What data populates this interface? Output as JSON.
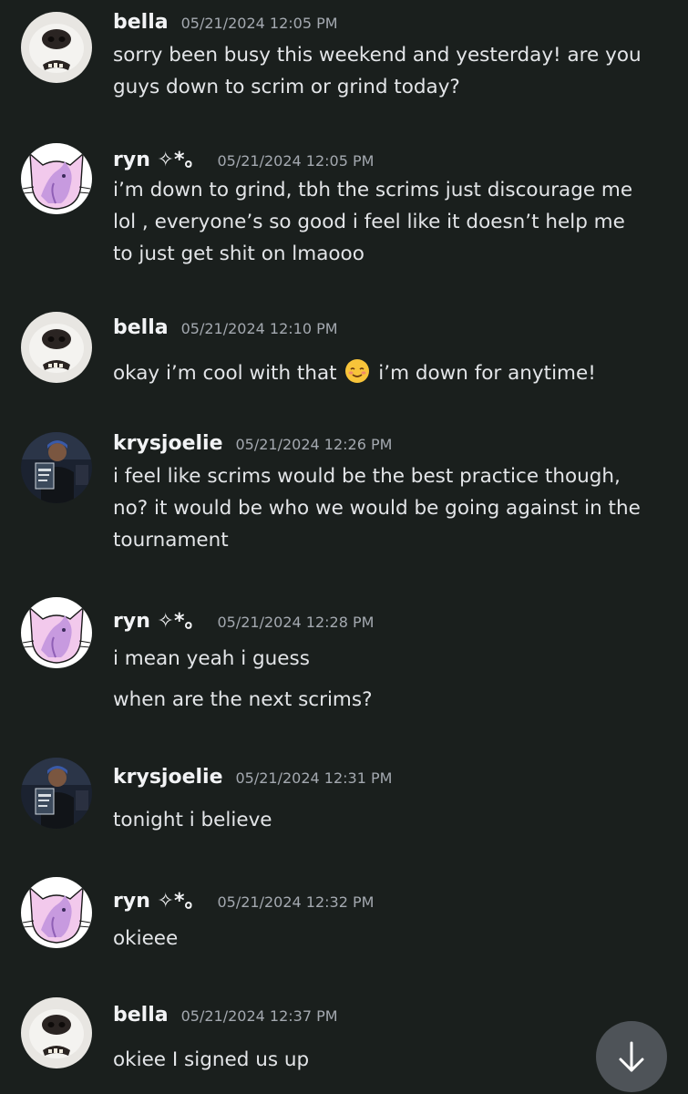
{
  "channel": {
    "messages": [
      {
        "author": "bella",
        "avatar": "dog-nose-avatar",
        "timestamp": "05/21/2024 12:05 PM",
        "lines": [
          "sorry been busy this weekend and yesterday! are you",
          "guys down to scrim or grind today?"
        ]
      },
      {
        "author": "ryn ✧*。",
        "avatar": "espeon-cat-avatar",
        "timestamp": "05/21/2024 12:05 PM",
        "lines": [
          "i’m down to grind, tbh the scrims just discourage me",
          "lol , everyone’s so good i feel like it doesn’t help me",
          "to just get shit on lmaooo"
        ]
      },
      {
        "author": "bella",
        "avatar": "dog-nose-avatar",
        "timestamp": "05/21/2024 12:10 PM",
        "lines_rich": {
          "before": "okay i’m cool with that",
          "emoji": "smiling-face-emoji",
          "after": "i’m down for anytime!"
        }
      },
      {
        "author": "krysjoelie",
        "avatar": "person-photo-avatar",
        "timestamp": "05/21/2024 12:26 PM",
        "lines": [
          "i feel like scrims would be the best practice though,",
          "no? it would be who we would be going against in the",
          "tournament"
        ]
      },
      {
        "author": "ryn ✧*。",
        "avatar": "espeon-cat-avatar",
        "timestamp": "05/21/2024 12:28 PM",
        "lines": [
          "i mean yeah i guess",
          "when are the next scrims?"
        ]
      },
      {
        "author": "krysjoelie",
        "avatar": "person-photo-avatar",
        "timestamp": "05/21/2024 12:31 PM",
        "lines": [
          "tonight i believe"
        ]
      },
      {
        "author": "ryn ✧*。",
        "avatar": "espeon-cat-avatar",
        "timestamp": "05/21/2024 12:32 PM",
        "lines": [
          "okieee"
        ]
      },
      {
        "author": "bella",
        "avatar": "dog-nose-avatar",
        "timestamp": "05/21/2024 12:37 PM",
        "lines": [
          "okiee I signed us up"
        ]
      }
    ]
  },
  "jump_button": {
    "icon": "arrow-down-icon"
  },
  "colors": {
    "background": "#1a1f1d",
    "username": "#f2f3f5",
    "timestamp": "#a4a9b0",
    "message_text": "#e3e5e8",
    "jump_button_bg": "#4e5358"
  }
}
